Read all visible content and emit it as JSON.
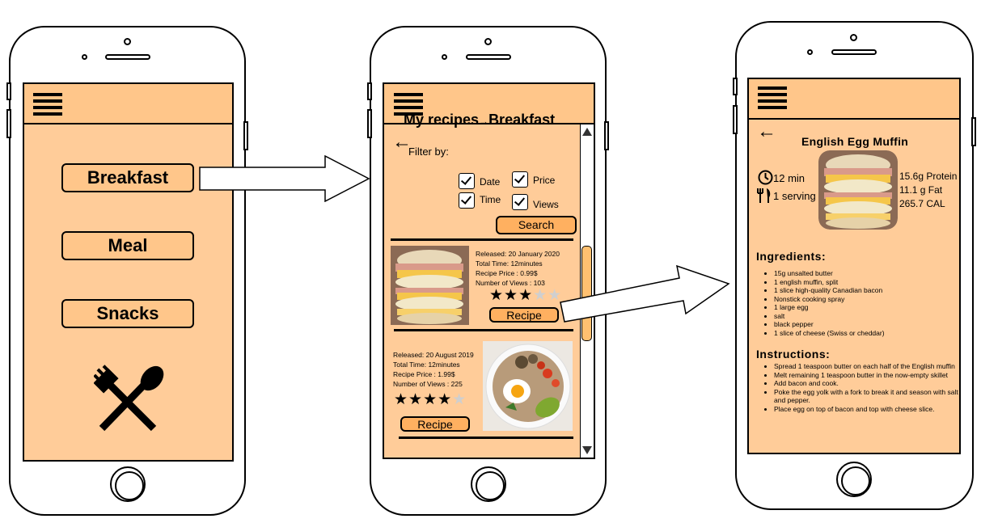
{
  "screen1": {
    "categories": [
      "Breakfast",
      "Meal",
      "Snacks"
    ]
  },
  "screen2": {
    "title_prefix": "My recipes",
    "title_arrow": "→",
    "title_category": "Breakfast",
    "filter_label": "Filter by:",
    "filters": [
      "Date",
      "Price",
      "Time",
      "Views"
    ],
    "search_label": "Search",
    "recipes": [
      {
        "released": "Released: 20 January 2020",
        "total_time": "Total Time: 12minutes",
        "price": "Recipe Price : 0.99$",
        "views": "Number of Views : 103",
        "rating": 3,
        "button": "Recipe"
      },
      {
        "released": "Released: 20 August 2019",
        "total_time": "Total Time: 12minutes",
        "price": "Recipe Price : 1.99$",
        "views": "Number of Views : 225",
        "rating": 4,
        "button": "Recipe"
      }
    ]
  },
  "screen3": {
    "title": "English Egg Muffin",
    "time": "12 min",
    "servings": "1 serving",
    "protein": "15.6g Protein",
    "fat": "11.1 g Fat",
    "calories": "265.7 CAL",
    "ingredients_heading": "Ingredients:",
    "ingredients": [
      "15g unsalted butter",
      "1 english muffin, split",
      "1 slice high-quality Canadian bacon",
      "Nonstick cooking spray",
      "1 large egg",
      "salt",
      "black pepper",
      "1 slice of cheese (Swiss or cheddar)"
    ],
    "instructions_heading": "Instructions:",
    "instructions": [
      "Spread 1 teaspoon butter on each half of the English muffin",
      "Melt remaining 1 teaspoon butter in the now-empty skillet",
      "Add bacon and cook.",
      "Poke the egg yolk with a fork to break it and season with salt and pepper.",
      "Place egg on top of bacon and top with cheese slice."
    ]
  },
  "colors": {
    "screen_bg": "#ffcc99",
    "topbar_bg": "#ffc68a",
    "button_bg": "#ffb060"
  }
}
